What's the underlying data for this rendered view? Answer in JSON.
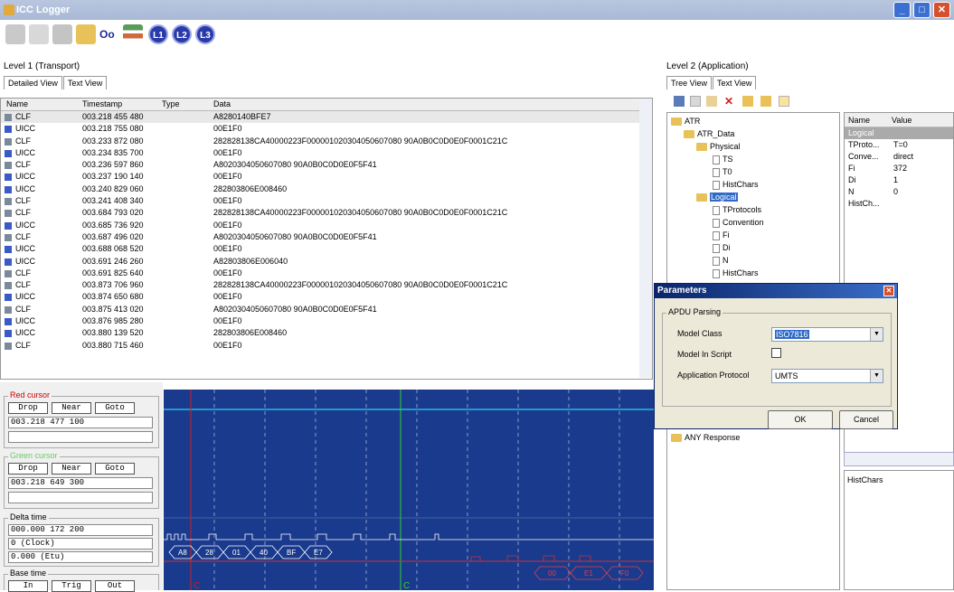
{
  "app": {
    "title": "ICC Logger"
  },
  "toolbar": {
    "l1": "L1",
    "l2": "L2",
    "l3": "L3",
    "oo": "Oo"
  },
  "left": {
    "title": "Level 1 (Transport)",
    "tab_detailed": "Detailed View",
    "tab_text": "Text View"
  },
  "table": {
    "columns": [
      "Name",
      "Timestamp",
      "Type",
      "Data"
    ],
    "rows": [
      [
        "CLF",
        "003.218 455 480",
        "",
        "A8280140BFE7"
      ],
      [
        "UICC",
        "003.218 755 080",
        "",
        "00E1F0"
      ],
      [
        "CLF",
        "003.233 872 080",
        "",
        "282828138CA40000223F000001020304050607080 90A0B0C0D0E0F0001C21C"
      ],
      [
        "UICC",
        "003.234 835 700",
        "",
        "00E1F0"
      ],
      [
        "CLF",
        "003.236 597 860",
        "",
        "A8020304050607080 90A0B0C0D0E0F5F41"
      ],
      [
        "UICC",
        "003.237 190 140",
        "",
        "00E1F0"
      ],
      [
        "UICC",
        "003.240 829 060",
        "",
        "282803806E008460"
      ],
      [
        "CLF",
        "003.241 408 340",
        "",
        "00E1F0"
      ],
      [
        "CLF",
        "003.684 793 020",
        "",
        "282828138CA40000223F000001020304050607080 90A0B0C0D0E0F0001C21C"
      ],
      [
        "UICC",
        "003.685 736 920",
        "",
        "00E1F0"
      ],
      [
        "CLF",
        "003.687 496 020",
        "",
        "A8020304050607080 90A0B0C0D0E0F5F41"
      ],
      [
        "UICC",
        "003.688 068 520",
        "",
        "00E1F0"
      ],
      [
        "UICC",
        "003.691 246 260",
        "",
        "A82803806E006040"
      ],
      [
        "CLF",
        "003.691 825 640",
        "",
        "00E1F0"
      ],
      [
        "CLF",
        "003.873 706 960",
        "",
        "282828138CA40000223F000001020304050607080 90A0B0C0D0E0F0001C21C"
      ],
      [
        "UICC",
        "003.874 650 680",
        "",
        "00E1F0"
      ],
      [
        "CLF",
        "003.875 413 020",
        "",
        "A8020304050607080 90A0B0C0D0E0F5F41"
      ],
      [
        "UICC",
        "003.876 985 280",
        "",
        "00E1F0"
      ],
      [
        "UICC",
        "003.880 139 520",
        "",
        "282803806E008460"
      ],
      [
        "CLF",
        "003.880 715 460",
        "",
        "00E1F0"
      ]
    ]
  },
  "cursors": {
    "red": {
      "title": "Red cursor",
      "drop": "Drop",
      "near": "Near",
      "goto": "Goto",
      "value": "003.218 477 100"
    },
    "green": {
      "title": "Green cursor",
      "drop": "Drop",
      "near": "Near",
      "goto": "Goto",
      "value": "003.218 649 300"
    },
    "delta": {
      "title": "Delta time",
      "v1": "000.000 172 200",
      "v2": "0 (Clock)",
      "v3": "0.000 (Etu)"
    },
    "base": {
      "title": "Base time",
      "b1": "In",
      "b2": "Trig",
      "b3": "Out"
    }
  },
  "wave": {
    "bytes_top": [
      "A8",
      "28",
      "01",
      "40",
      "BF",
      "E7"
    ],
    "bytes_bottom": [
      "00",
      "E1",
      "F0"
    ],
    "marker_red": "C",
    "marker_green": "C"
  },
  "right": {
    "title": "Level 2 (Application)",
    "tab_tree": "Tree View",
    "tab_text": "Text View"
  },
  "tree": {
    "atr": "ATR",
    "atr_data": "ATR_Data",
    "physical": "Physical",
    "ts": "TS",
    "t0": "T0",
    "histchars": "HistChars",
    "logical": "Logical",
    "tprotocols": "TProtocols",
    "convention": "Convention",
    "fi": "Fi",
    "di": "Di",
    "n": "N",
    "histchars2": "HistChars",
    "any": "ANY Response"
  },
  "props": {
    "col_name": "Name",
    "col_value": "Value",
    "rows": [
      [
        "Logical",
        ""
      ],
      [
        "TProto...",
        "T=0"
      ],
      [
        "Conve...",
        "direct"
      ],
      [
        "Fi",
        "372"
      ],
      [
        "Di",
        "1"
      ],
      [
        "N",
        "0"
      ],
      [
        "HistCh...",
        ""
      ]
    ],
    "detail": "HistChars"
  },
  "dialog": {
    "title": "Parameters",
    "group": "APDU Parsing",
    "model_class_label": "Model Class",
    "model_class_value": "ISO7816",
    "model_script_label": "Model In Script",
    "app_protocol_label": "Application Protocol",
    "app_protocol_value": "UMTS",
    "ok": "OK",
    "cancel": "Cancel"
  }
}
